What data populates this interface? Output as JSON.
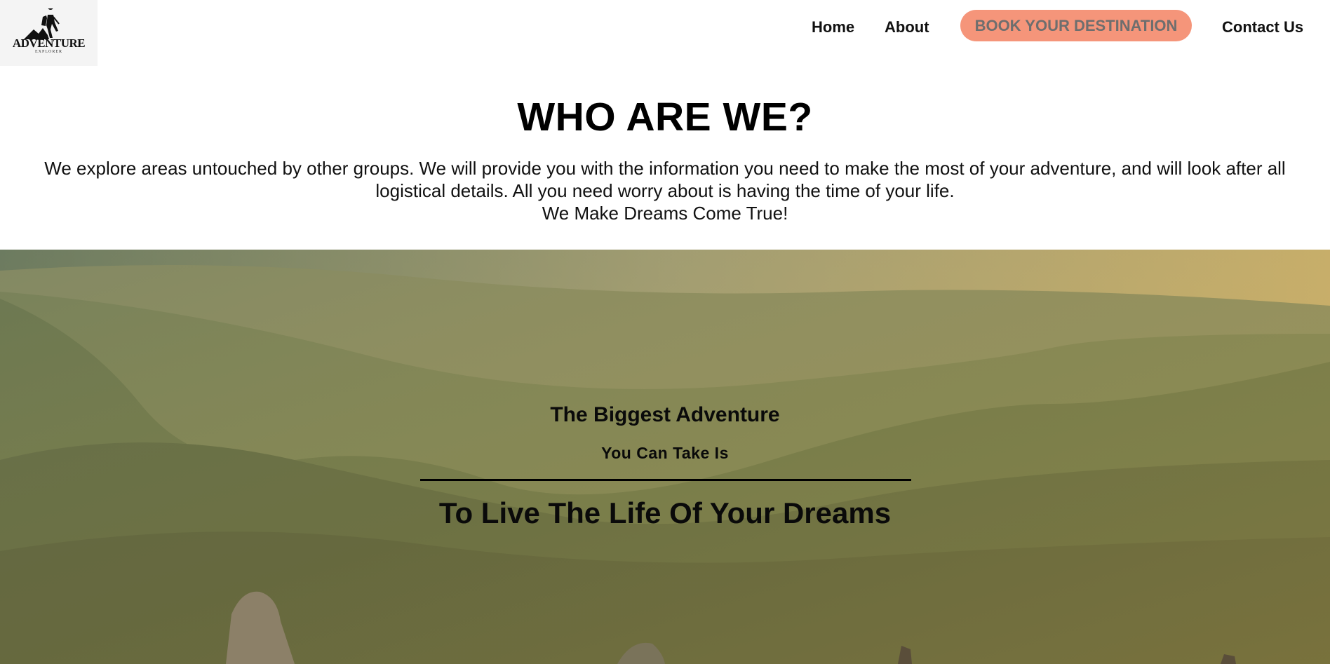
{
  "logo": {
    "brand": "ADVENTURE",
    "subtitle": "EXPLORER",
    "icon": "hiker-icon"
  },
  "nav": {
    "home": "Home",
    "about": "About",
    "book": "BOOK YOUR DESTINATION",
    "contact": "Contact Us"
  },
  "about": {
    "title": "WHO ARE WE?",
    "body": "We explore areas untouched by other groups. We will provide you with the information you need to make the most of your adventure, and will look after all logistical details. All you need worry about is having the time of your life.",
    "tagline": "We Make Dreams Come True!"
  },
  "hero": {
    "title": "The Biggest Adventure",
    "subtitle": "You Can Take Is",
    "headline": "To Live The Life Of Your Dreams"
  },
  "colors": {
    "accent": "#f5957a",
    "accent_text": "#6e6e6e"
  }
}
